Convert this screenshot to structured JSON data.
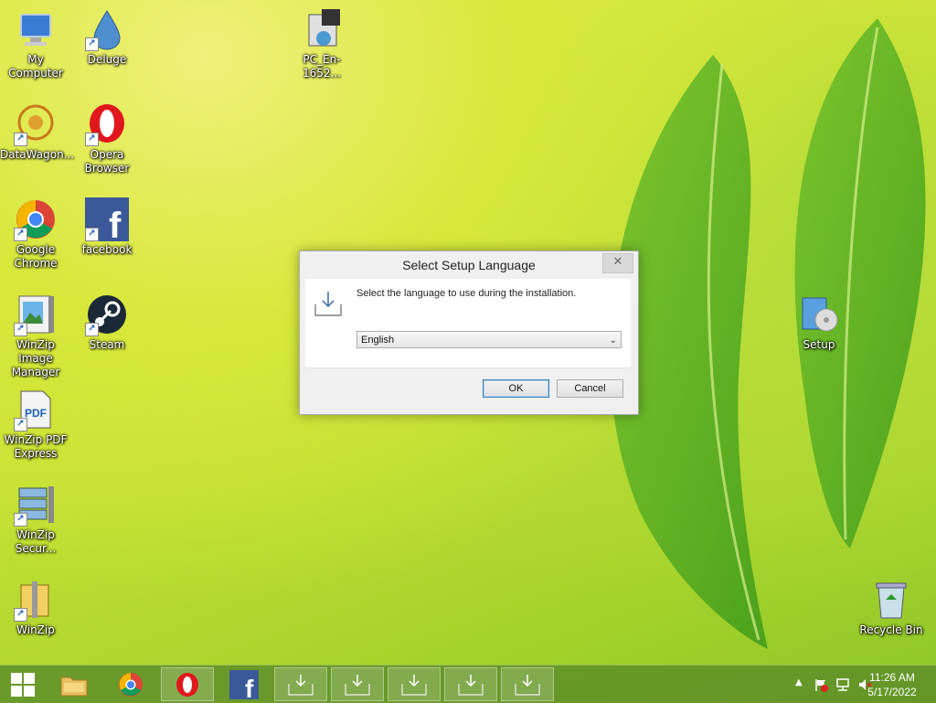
{
  "desktop": {
    "icons": [
      {
        "label": "My Computer"
      },
      {
        "label": "Deluge"
      },
      {
        "label": "PC_En-1652..."
      },
      {
        "label": "DataWagon..."
      },
      {
        "label": "Opera Browser"
      },
      {
        "label": "Google Chrome"
      },
      {
        "label": "facebook"
      },
      {
        "label": "WinZip Image Manager"
      },
      {
        "label": "Steam"
      },
      {
        "label": "Setup"
      },
      {
        "label": "WinZip PDF Express"
      },
      {
        "label": "WinZip Secur..."
      },
      {
        "label": "WinZip"
      },
      {
        "label": "Recycle Bin"
      }
    ]
  },
  "dialog": {
    "title": "Select Setup Language",
    "close_glyph": "✕",
    "message": "Select the language to use during the installation.",
    "language_selected": "English",
    "ok_label": "OK",
    "cancel_label": "Cancel"
  },
  "taskbar": {
    "clock_time": "11:26 AM",
    "clock_date": "5/17/2022"
  },
  "colors": {
    "accent": "#3c7fb1",
    "taskbar": "#5a8c28"
  }
}
